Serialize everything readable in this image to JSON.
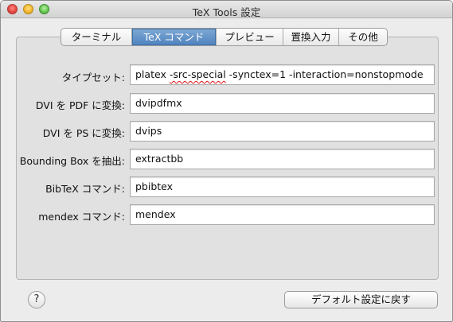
{
  "window": {
    "title": "TeX Tools 設定"
  },
  "tabs": [
    {
      "label": "ターミナル"
    },
    {
      "label": "TeX コマンド",
      "active": true
    },
    {
      "label": "プレビュー"
    },
    {
      "label": "置換入力"
    },
    {
      "label": "その他"
    }
  ],
  "settings": {
    "typeset": {
      "label": "タイプセット:",
      "value_prefix": "platex ",
      "value_flagged": "-src-special",
      "value_suffix": " -synctex=1 -interaction=nonstopmode"
    },
    "dvi_pdf": {
      "label": "DVI を PDF に変換:",
      "value": "dvipdfmx"
    },
    "dvi_ps": {
      "label": "DVI を PS に変換:",
      "value": "dvips"
    },
    "bbox": {
      "label": "Bounding Box を抽出:",
      "value": "extractbb"
    },
    "bibtex": {
      "label": "BibTeX コマンド:",
      "value": "pbibtex"
    },
    "mendex": {
      "label": "mendex コマンド:",
      "value": "mendex"
    }
  },
  "footer": {
    "help_label": "?",
    "reset_label": "デフォルト設定に戻す"
  },
  "colors": {
    "active_tab": "#4e82bf",
    "spellcheck_underline": "#dd1111"
  }
}
